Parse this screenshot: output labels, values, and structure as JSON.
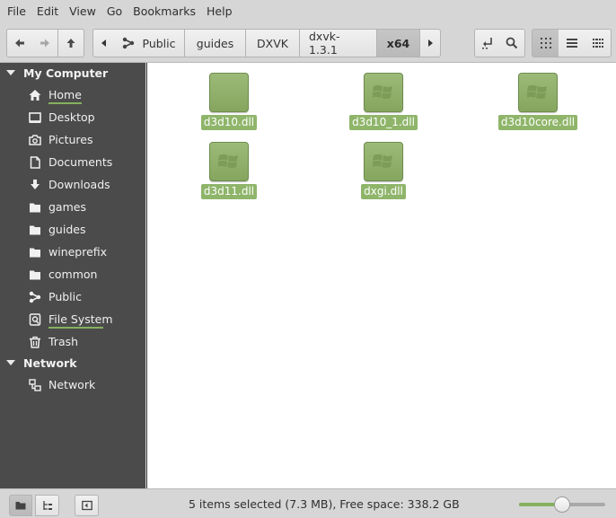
{
  "menubar": {
    "items": [
      {
        "label": "File"
      },
      {
        "label": "Edit"
      },
      {
        "label": "View"
      },
      {
        "label": "Go"
      },
      {
        "label": "Bookmarks"
      },
      {
        "label": "Help"
      }
    ]
  },
  "toolbar": {
    "breadcrumbs": [
      {
        "label": "Public",
        "icon": "share-icon"
      },
      {
        "label": "guides"
      },
      {
        "label": "DXVK"
      },
      {
        "label": "dxvk-1.3.1"
      },
      {
        "label": "x64",
        "active": true
      }
    ]
  },
  "sidebar": {
    "sections": [
      {
        "title": "My Computer"
      },
      {
        "title": "Network"
      }
    ],
    "items": [
      {
        "label": "Home",
        "icon": "home-icon",
        "usage_fraction": 0.55
      },
      {
        "label": "Desktop",
        "icon": "desktop-icon"
      },
      {
        "label": "Pictures",
        "icon": "camera-icon"
      },
      {
        "label": "Documents",
        "icon": "document-icon"
      },
      {
        "label": "Downloads",
        "icon": "download-icon"
      },
      {
        "label": "games",
        "icon": "folder-icon"
      },
      {
        "label": "guides",
        "icon": "folder-icon"
      },
      {
        "label": "wineprefix",
        "icon": "folder-icon"
      },
      {
        "label": "common",
        "icon": "folder-icon"
      },
      {
        "label": "Public",
        "icon": "share-icon"
      },
      {
        "label": "File System",
        "icon": "drive-icon",
        "usage_fraction": 0.9
      },
      {
        "label": "Trash",
        "icon": "trash-icon"
      },
      {
        "label": "Network",
        "icon": "network-icon"
      }
    ]
  },
  "files": [
    {
      "name": "d3d10.dll"
    },
    {
      "name": "d3d10_1.dll"
    },
    {
      "name": "d3d10core.dll"
    },
    {
      "name": "d3d11.dll"
    },
    {
      "name": "dxgi.dll"
    }
  ],
  "statusbar": {
    "text": "5 items selected (7.3 MB), Free space: 338.2 GB",
    "zoom_fraction": 0.5
  },
  "colors": {
    "accent": "#86b05f",
    "sidebar_bg": "#4b4b4b",
    "selection": "#8fb56a"
  }
}
